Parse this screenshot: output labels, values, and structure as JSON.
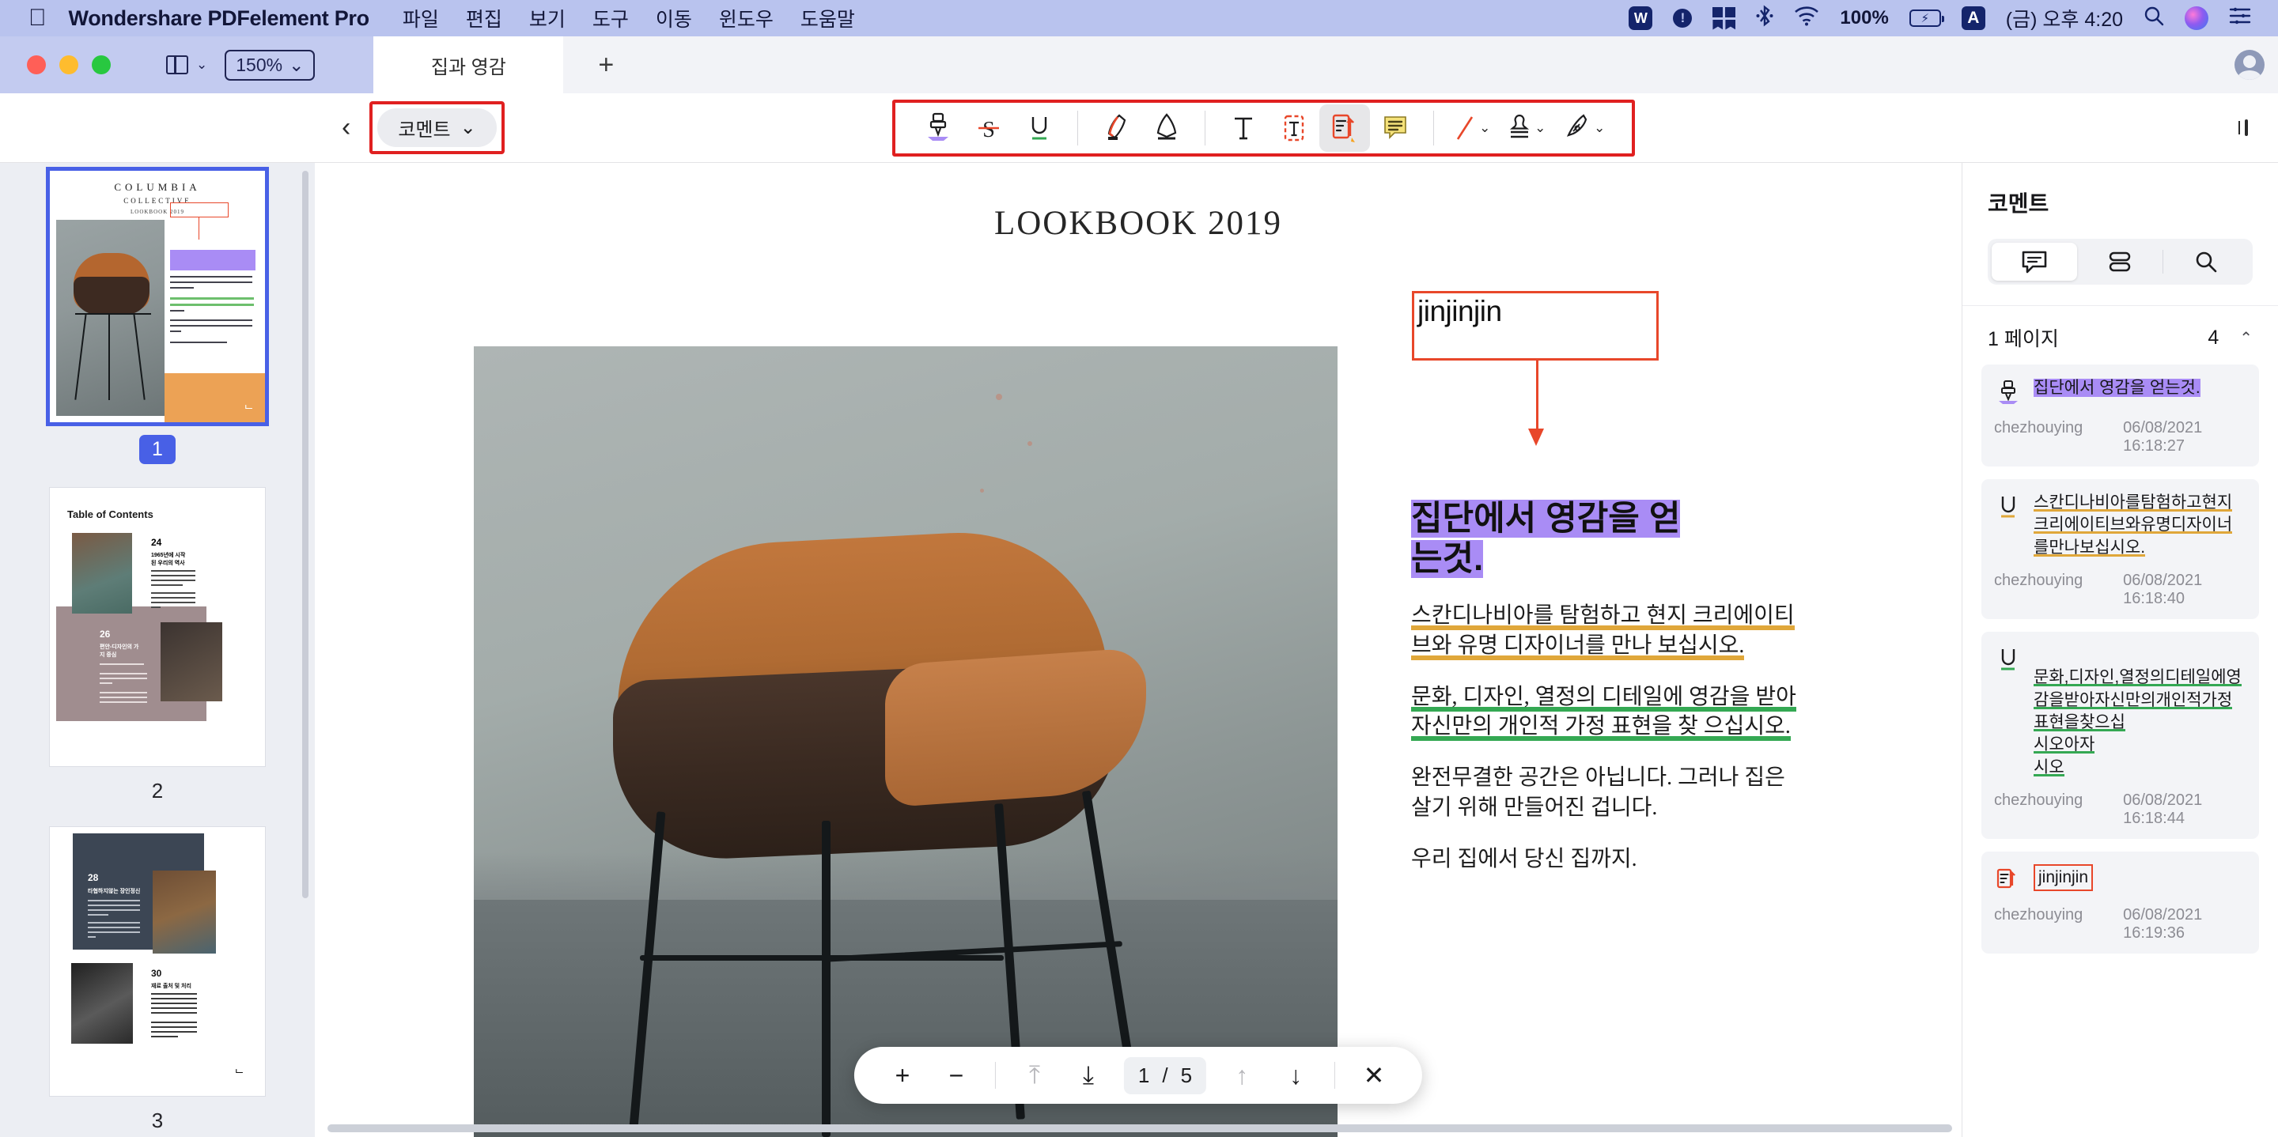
{
  "macbar": {
    "apple_glyph": "",
    "app_name": "Wondershare PDFelement Pro",
    "menus": [
      "파일",
      "편집",
      "보기",
      "도구",
      "이동",
      "윈도우",
      "도움말"
    ],
    "wps_label": "W",
    "excl_label": "!",
    "battery_percent": "100%",
    "input_source": "A",
    "clock": "(금) 오후 4:20"
  },
  "window": {
    "sidebar_toggle_caret": "⌄",
    "zoom_level": "150%",
    "zoom_caret": "⌄",
    "tab_title": "집과 영감",
    "new_tab_glyph": "+"
  },
  "toolbar": {
    "back_glyph": "‹",
    "mode_label": "코멘트",
    "mode_caret": "⌄",
    "tools": [
      {
        "name": "stamp-comment-tool",
        "label": "도장 코멘트",
        "selected": false
      },
      {
        "name": "strikethrough-tool",
        "label": "취소선",
        "selected": false
      },
      {
        "name": "underline-tool",
        "label": "밑줄",
        "selected": false
      },
      {
        "name": "highlight-tool",
        "label": "형광펜",
        "selected": false
      },
      {
        "name": "eraser-tool",
        "label": "지우개",
        "selected": false
      },
      {
        "name": "text-tool",
        "label": "텍스트",
        "selected": false
      },
      {
        "name": "text-box-tool",
        "label": "텍스트 상자",
        "selected": false
      },
      {
        "name": "callout-tool",
        "label": "콜아웃",
        "selected": true
      },
      {
        "name": "note-tool",
        "label": "노트",
        "selected": false
      },
      {
        "name": "line-shape-tool",
        "label": "선",
        "selected": false,
        "caret": "⌄"
      },
      {
        "name": "stamp-tool",
        "label": "스탬프",
        "selected": false,
        "caret": "⌄"
      },
      {
        "name": "signature-tool",
        "label": "서명",
        "selected": false,
        "caret": "⌄"
      }
    ],
    "highlight_border_color": "#e02020"
  },
  "thumbnails": [
    {
      "number": "1",
      "active": true,
      "title": "COLUMBIA",
      "subtitle": "COLLECTIVE",
      "caption": "LOOKBOOK 2019"
    },
    {
      "number": "2",
      "active": false,
      "title": "Table of Contents",
      "entry_a": "24",
      "entry_a_l1": "1965년에 시작",
      "entry_a_l2": "된 우리의 역사",
      "entry_b": "26",
      "entry_b_l1": "편안-디자인의 가",
      "entry_b_l2": "지 중심"
    },
    {
      "number": "3",
      "active": false,
      "entry_a": "28",
      "entry_a_l1": "타협하지않는 장인정신",
      "entry_b": "30",
      "entry_b_l1": "재료 출처 및 처리"
    }
  ],
  "document": {
    "header": "LOOKBOOK 2019",
    "callout_text": "jinjinjin",
    "headline_line1": "집단에서 영감을 얻",
    "headline_line2": "는것.",
    "paragraph_1": "스칸디나비아를 탐험하고 현지 크리에이티브와 유명 디자이너를 만나 보십시오.",
    "paragraph_2": "문화, 디자인, 열정의 디테일에 영감을 받아 자신만의 개인적 가정 표현을 찾 으십시오.",
    "paragraph_3": "완전무결한 공간은 아닙니다. 그러나 집은 살기 위해 만들어진 겁니다.",
    "paragraph_4": "우리 집에서 당신 집까지.",
    "callout_border_color": "#e8472a",
    "highlight_color": "#a98cf5",
    "underline_amber": "#e0a73a",
    "underline_green": "#34a853"
  },
  "floatbar": {
    "zoom_in": "+",
    "zoom_out": "−",
    "first_page": "⤒",
    "prev_block": "⤓",
    "current_page": "1",
    "separator": "/",
    "total_pages": "5",
    "up": "↑",
    "down": "↓",
    "close": "✕"
  },
  "comments_panel": {
    "title": "코멘트",
    "segments": [
      {
        "name": "comment-list-tab",
        "icon": "speech-bubble-icon",
        "active": true
      },
      {
        "name": "comment-group-tab",
        "icon": "stacked-rows-icon",
        "active": false
      },
      {
        "name": "comment-search-tab",
        "icon": "search-icon",
        "active": false
      }
    ],
    "group_label": "1 페이지",
    "group_count": "4",
    "group_collapse": "⌃",
    "items": [
      {
        "icon": "stamp-comment-icon",
        "icon_kind": "stamp",
        "text": "집단에서 영감을 얻는것.",
        "style": "highlight-purple",
        "author": "chezhouying",
        "timestamp": "06/08/2021 16:18:27"
      },
      {
        "icon": "underline-icon",
        "icon_kind": "underline-amber",
        "text": "스칸디나비아를탐험하고현지크리에이티브와유명디자이너를만나보십시오.",
        "style": "underline-amber",
        "author": "chezhouying",
        "timestamp": "06/08/2021 16:18:40"
      },
      {
        "icon": "underline-icon",
        "icon_kind": "underline-green",
        "text": "문화,디자인,열정의디테일에영감을받아자신만의개인적가정표현을찾으십\n시오아자\n시오",
        "style": "underline-green",
        "author": "chezhouying",
        "timestamp": "06/08/2021 16:18:44"
      },
      {
        "icon": "callout-icon",
        "icon_kind": "callout",
        "text": "jinjinjin",
        "style": "box-red",
        "author": "chezhouying",
        "timestamp": "06/08/2021 16:19:36"
      }
    ]
  }
}
